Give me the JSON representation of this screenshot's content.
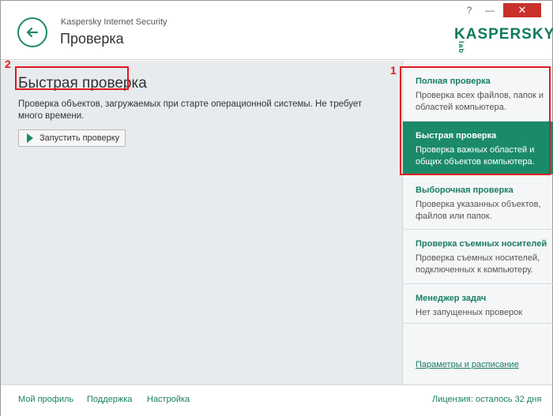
{
  "header": {
    "app_name": "Kaspersky Internet Security",
    "title": "Проверка",
    "logo": "KASPERSKY",
    "logo_suffix": "lab",
    "help": "?",
    "minimize": "—",
    "close": "✕"
  },
  "main": {
    "title": "Быстрая проверка",
    "description": "Проверка объектов, загружаемых при старте операционной системы. Не требует много времени.",
    "start_button": "Запустить проверку",
    "annotation": "2"
  },
  "sidebar": {
    "annotation": "1",
    "items": [
      {
        "title": "Полная проверка",
        "desc": "Проверка всех файлов, папок и областей компьютера."
      },
      {
        "title": "Быстрая проверка",
        "desc": "Проверка важных областей и общих объектов компьютера."
      },
      {
        "title": "Выборочная проверка",
        "desc": "Проверка указанных объектов, файлов или папок."
      },
      {
        "title": "Проверка съемных носителей",
        "desc": "Проверка съемных носителей, подключенных к компьютеру."
      },
      {
        "title": "Менеджер задач",
        "desc": "Нет запущенных проверок"
      }
    ],
    "settings_link": "Параметры и расписание"
  },
  "footer": {
    "links": [
      "Мой профиль",
      "Поддержка",
      "Настройка"
    ],
    "license": "Лицензия: осталось 32 дня"
  },
  "colors": {
    "accent": "#1a8a6b",
    "annotation_red": "#e0191f",
    "main_bg": "#e7ebee"
  }
}
